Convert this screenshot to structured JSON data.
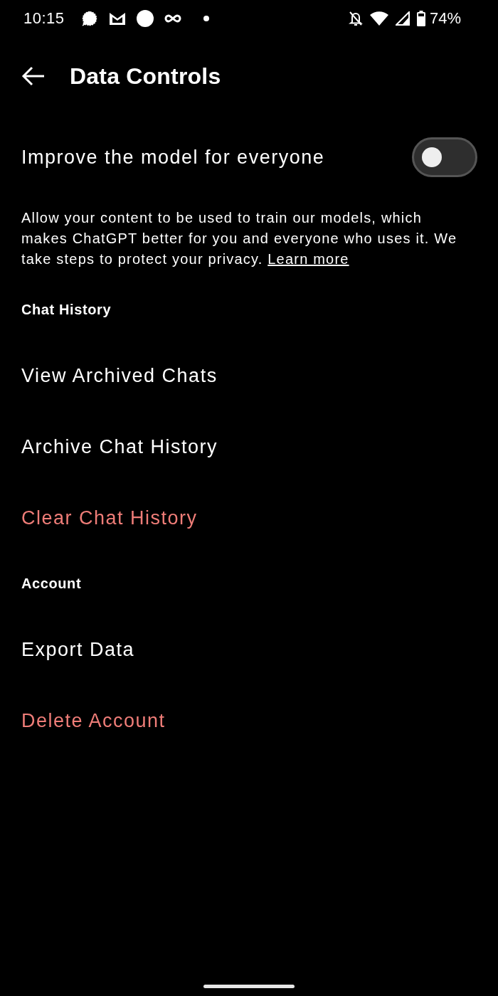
{
  "status_bar": {
    "time": "10:15",
    "battery": "74%"
  },
  "app_bar": {
    "title": "Data Controls"
  },
  "toggle_row": {
    "label": "Improve the model for everyone",
    "on": false
  },
  "description": {
    "text": "Allow your content to be used to train our models, which makes ChatGPT better for you and everyone who uses it. We take steps to protect your privacy.",
    "link": "Learn more"
  },
  "sections": [
    {
      "title": "Chat History",
      "items": [
        {
          "label": "View Archived Chats",
          "kind": "normal"
        },
        {
          "label": "Archive Chat History",
          "kind": "normal"
        },
        {
          "label": "Clear Chat History",
          "kind": "destructive"
        }
      ]
    },
    {
      "title": "Account",
      "items": [
        {
          "label": "Export Data",
          "kind": "normal"
        },
        {
          "label": "Delete Account",
          "kind": "destructive"
        }
      ]
    }
  ]
}
